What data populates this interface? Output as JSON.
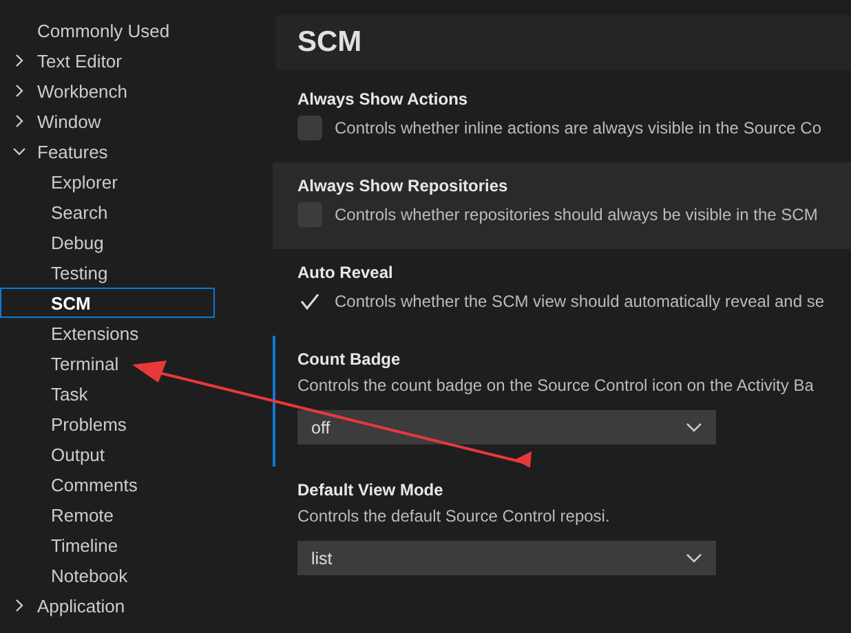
{
  "sidebar": {
    "items": [
      {
        "label": "Commonly Used",
        "selected": false
      },
      {
        "label": "Text Editor",
        "expanded": false,
        "selected": false
      },
      {
        "label": "Workbench",
        "expanded": false,
        "selected": false
      },
      {
        "label": "Window",
        "expanded": false,
        "selected": false
      },
      {
        "label": "Features",
        "expanded": true,
        "selected": false,
        "children": [
          {
            "label": "Explorer",
            "selected": false
          },
          {
            "label": "Search",
            "selected": false
          },
          {
            "label": "Debug",
            "selected": false
          },
          {
            "label": "Testing",
            "selected": false
          },
          {
            "label": "SCM",
            "selected": true
          },
          {
            "label": "Extensions",
            "selected": false
          },
          {
            "label": "Terminal",
            "selected": false
          },
          {
            "label": "Task",
            "selected": false
          },
          {
            "label": "Problems",
            "selected": false
          },
          {
            "label": "Output",
            "selected": false
          },
          {
            "label": "Comments",
            "selected": false
          },
          {
            "label": "Remote",
            "selected": false
          },
          {
            "label": "Timeline",
            "selected": false
          },
          {
            "label": "Notebook",
            "selected": false
          }
        ]
      },
      {
        "label": "Application",
        "expanded": false,
        "selected": false
      }
    ]
  },
  "section_title": "SCM",
  "settings": [
    {
      "kind": "checkbox",
      "title": "Always Show Actions",
      "description": "Controls whether inline actions are always visible in the Source Co",
      "checked": false,
      "focused": false,
      "hovered": false
    },
    {
      "kind": "checkbox",
      "title": "Always Show Repositories",
      "description": "Controls whether repositories should always be visible in the SCM",
      "checked": false,
      "focused": false,
      "hovered": true
    },
    {
      "kind": "checkbox",
      "title": "Auto Reveal",
      "description": "Controls whether the SCM view should automatically reveal and se",
      "checked": true,
      "focused": false,
      "hovered": false
    },
    {
      "kind": "dropdown",
      "title": "Count Badge",
      "description": "Controls the count badge on the Source Control icon on the Activity Ba",
      "value": "off",
      "focused": true,
      "hovered": false
    },
    {
      "kind": "dropdown",
      "title": "Default View Mode",
      "description": "Controls the default Source Control reposi.",
      "value": "list",
      "focused": false,
      "hovered": false
    }
  ]
}
